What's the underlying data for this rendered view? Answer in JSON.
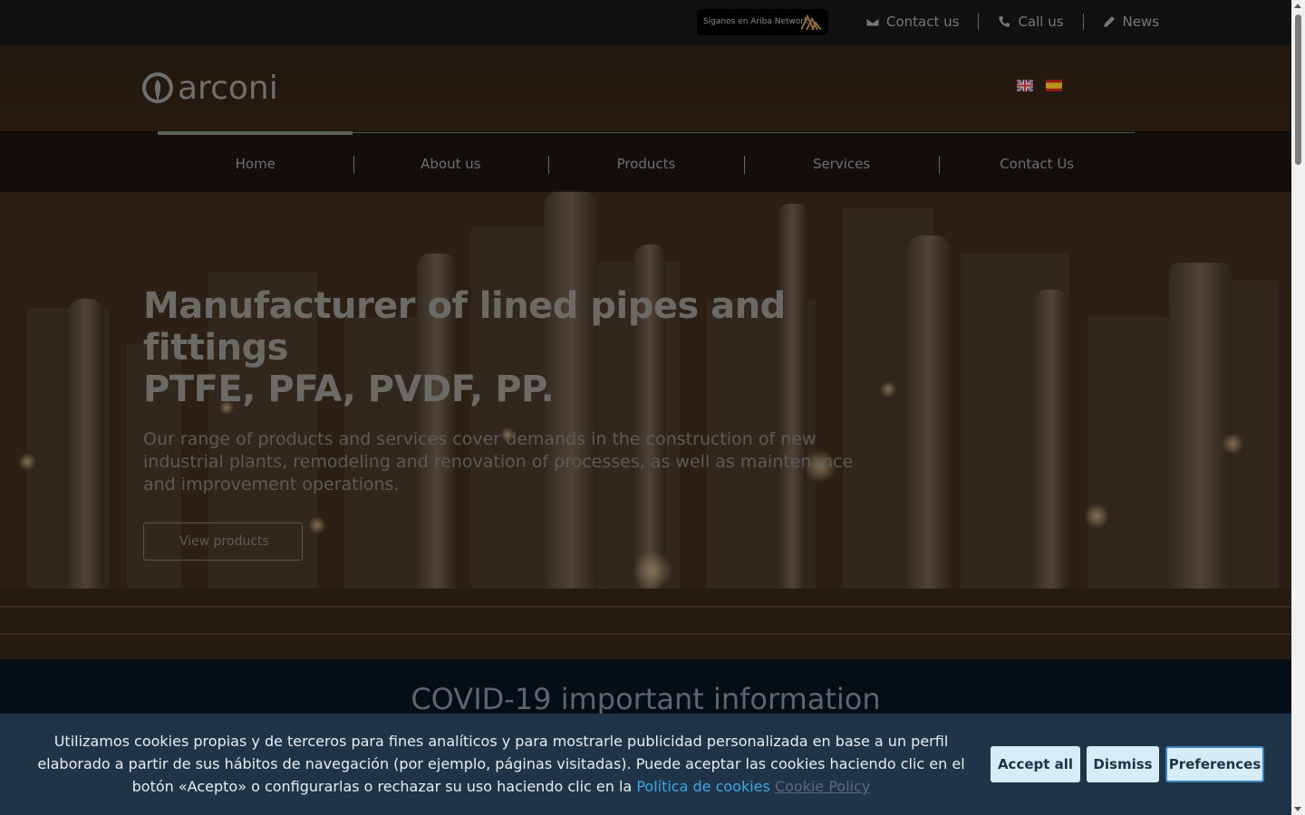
{
  "topbar": {
    "ariba_label": "Síganos en Ariba Network",
    "links": [
      {
        "label": "Contact us",
        "icon": "envelope-icon"
      },
      {
        "label": "Call us",
        "icon": "phone-icon"
      },
      {
        "label": "News",
        "icon": "pencil-icon"
      }
    ]
  },
  "header": {
    "logo_text": "arconi",
    "languages": [
      {
        "code": "en",
        "icon": "uk-flag-icon"
      },
      {
        "code": "es",
        "icon": "spain-flag-icon"
      }
    ]
  },
  "nav": {
    "items": [
      "Home",
      "About us",
      "Products",
      "Services",
      "Contact Us"
    ],
    "active": "Home"
  },
  "hero": {
    "title_line1": "Manufacturer of lined pipes and fittings",
    "title_line2": "PTFE, PFA, PVDF, PP.",
    "subtitle": "Our range of products and services cover demands in the construction of new industrial plants, remodeling and renovation of processes, as well as maintenance and improvement operations.",
    "button_label": "View products"
  },
  "covid": {
    "title": "COVID-19 important information"
  },
  "cookie_banner": {
    "text": "Utilizamos cookies propias y de terceros para fines analíticos y para mostrarle publicidad personalizada en base a un perfil elaborado a partir de sus hábitos de navegación (por ejemplo, páginas visitadas). Puede aceptar las cookies haciendo clic en el botón «Acepto» o configurarlas o rechazar su uso haciendo clic en la",
    "policy_link": "Política de cookies",
    "policy_link2": "Cookie Policy",
    "accept_label": "Accept all",
    "dismiss_label": "Dismiss",
    "preferences_label": "Preferences"
  },
  "colors": {
    "cookie_bg": "#1f3446",
    "button_bg": "#d7ecf9",
    "link": "#3ea7e8",
    "covid_bg": "#050d17"
  }
}
